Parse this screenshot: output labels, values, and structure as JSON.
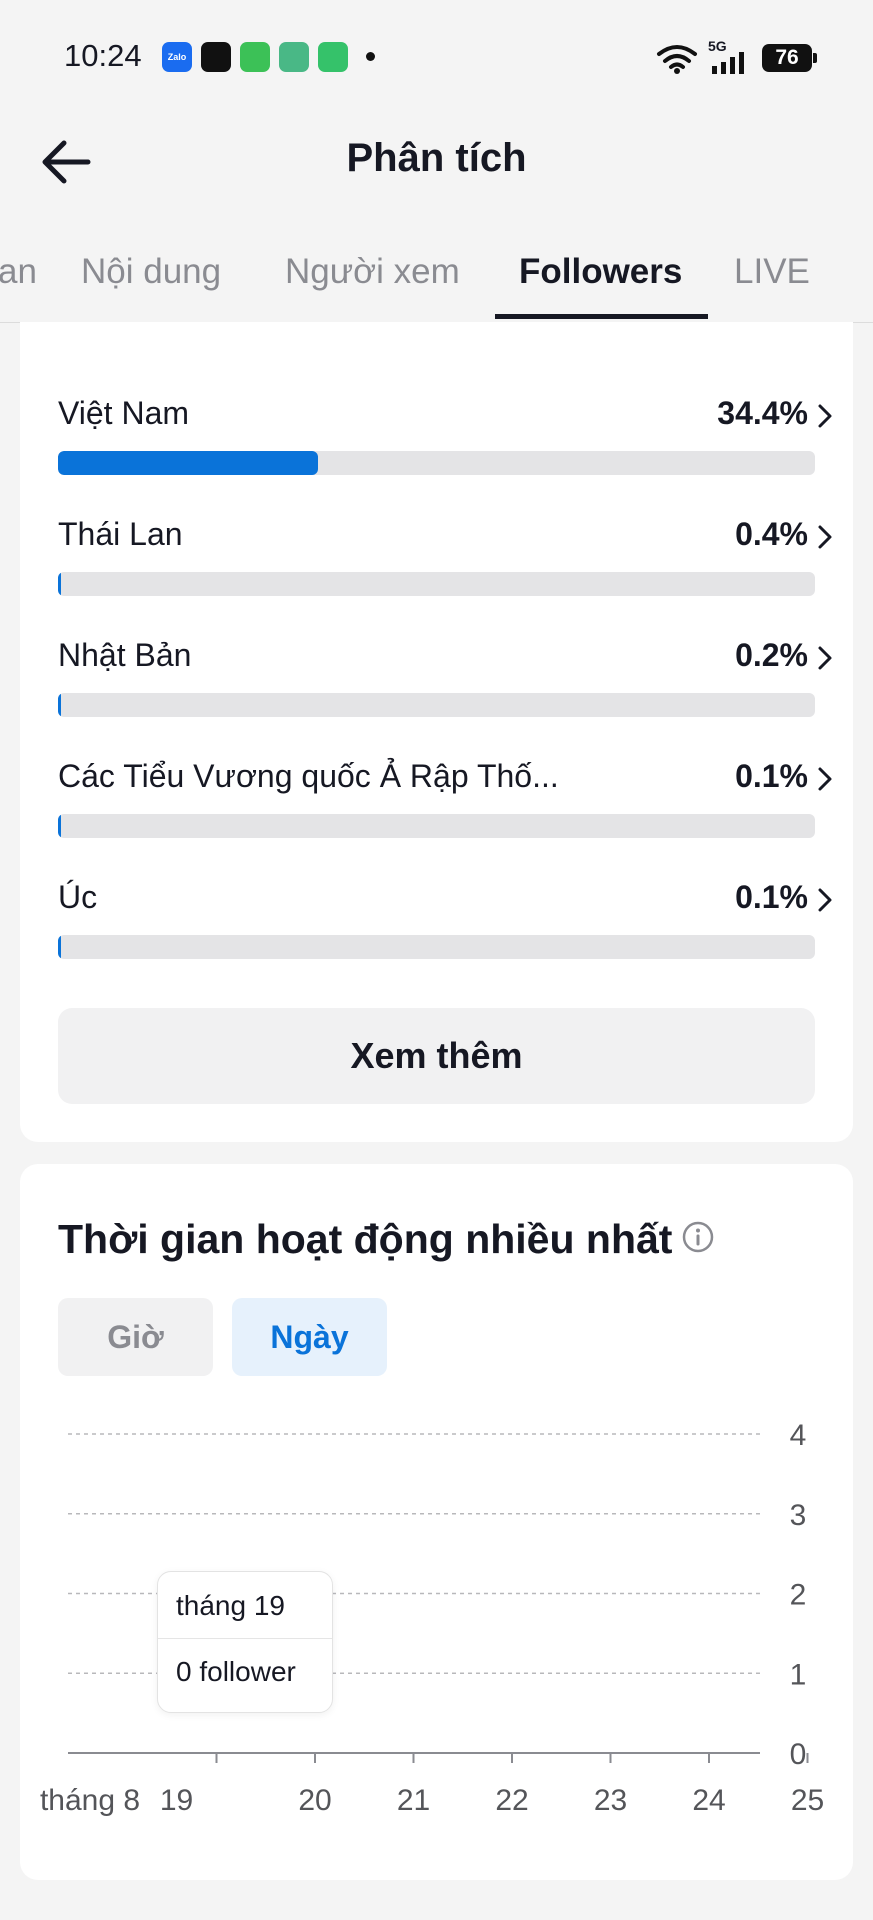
{
  "status_bar": {
    "time": "10:24",
    "network": "5G",
    "battery": "76",
    "apps": [
      {
        "icon": "zalo-icon",
        "label": "Zalo",
        "color": "#1a6cf0"
      },
      {
        "icon": "tiktok-icon",
        "color": "#111111"
      },
      {
        "icon": "messages-icon",
        "color": "#3cc157"
      },
      {
        "icon": "download-icon",
        "color": "#49b886"
      },
      {
        "icon": "battery-saver-icon",
        "color": "#35c26a"
      }
    ]
  },
  "header": {
    "title": "Phân tích",
    "back_icon": "arrow-left-icon"
  },
  "tabs": [
    {
      "label": "an",
      "active": false
    },
    {
      "label": "Nội dung",
      "active": false
    },
    {
      "label": "Người xem",
      "active": false
    },
    {
      "label": "Followers",
      "active": true
    },
    {
      "label": "LIVE",
      "active": false
    }
  ],
  "countries": [
    {
      "name": "Việt Nam",
      "percent_label": "34.4%",
      "share": 0.344
    },
    {
      "name": "Thái Lan",
      "percent_label": "0.4%",
      "share": 0.004
    },
    {
      "name": "Nhật Bản",
      "percent_label": "0.2%",
      "share": 0.002
    },
    {
      "name": "Các Tiểu Vương quốc Ả Rập Thố...",
      "percent_label": "0.1%",
      "share": 0.001
    },
    {
      "name": "Úc",
      "percent_label": "0.1%",
      "share": 0.001
    }
  ],
  "see_more_label": "Xem thêm",
  "activity": {
    "title": "Thời gian hoạt động nhiều nhất",
    "segments": [
      {
        "label": "Giờ",
        "active": false
      },
      {
        "label": "Ngày",
        "active": true
      }
    ],
    "tooltip": {
      "date": "tháng 19",
      "value": "0 follower"
    }
  },
  "colors": {
    "accent": "#0a73d9",
    "track": "#e4e4e6",
    "text": "#161823",
    "muted": "#8a8b91"
  },
  "chart_data": {
    "type": "line",
    "x_tick_labels": [
      "tháng 8",
      "19",
      "20",
      "21",
      "22",
      "23",
      "24",
      "25"
    ],
    "x": [
      18,
      19,
      20,
      21,
      22,
      23,
      24,
      25
    ],
    "y_tick_labels": [
      "0",
      "1",
      "2",
      "3",
      "4"
    ],
    "ylim": [
      0,
      4
    ],
    "y_axis_position": "right",
    "grid": true,
    "series": [
      {
        "values": [
          0,
          0,
          0,
          0,
          0,
          0,
          0,
          0
        ]
      }
    ]
  }
}
